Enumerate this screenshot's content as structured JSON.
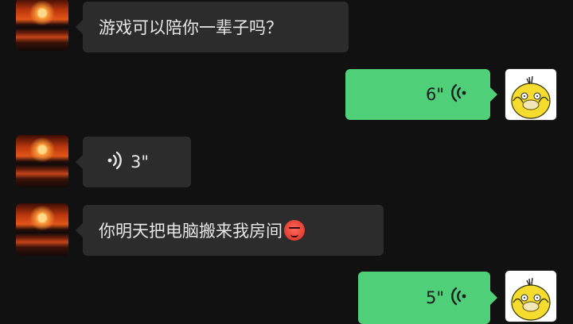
{
  "messages": [
    {
      "side": "incoming",
      "type": "text",
      "avatar": "sunset-avatar",
      "text": "游戏可以陪你一辈子吗？"
    },
    {
      "side": "outgoing",
      "type": "voice",
      "avatar": "psyduck-avatar",
      "duration": "6\"",
      "icon": "voice-wave-icon"
    },
    {
      "side": "incoming",
      "type": "voice",
      "avatar": "sunset-avatar",
      "duration": "3\"",
      "icon": "voice-wave-icon"
    },
    {
      "side": "incoming",
      "type": "text",
      "avatar": "sunset-avatar",
      "text": "你明天把电脑搬来我房间",
      "emoji": "angry-face-icon"
    },
    {
      "side": "outgoing",
      "type": "voice",
      "avatar": "psyduck-avatar",
      "duration": "5\"",
      "icon": "voice-wave-icon"
    }
  ],
  "colors": {
    "background": "#111111",
    "incoming_bubble": "#2c2c2c",
    "outgoing_bubble": "#4fcf78"
  }
}
